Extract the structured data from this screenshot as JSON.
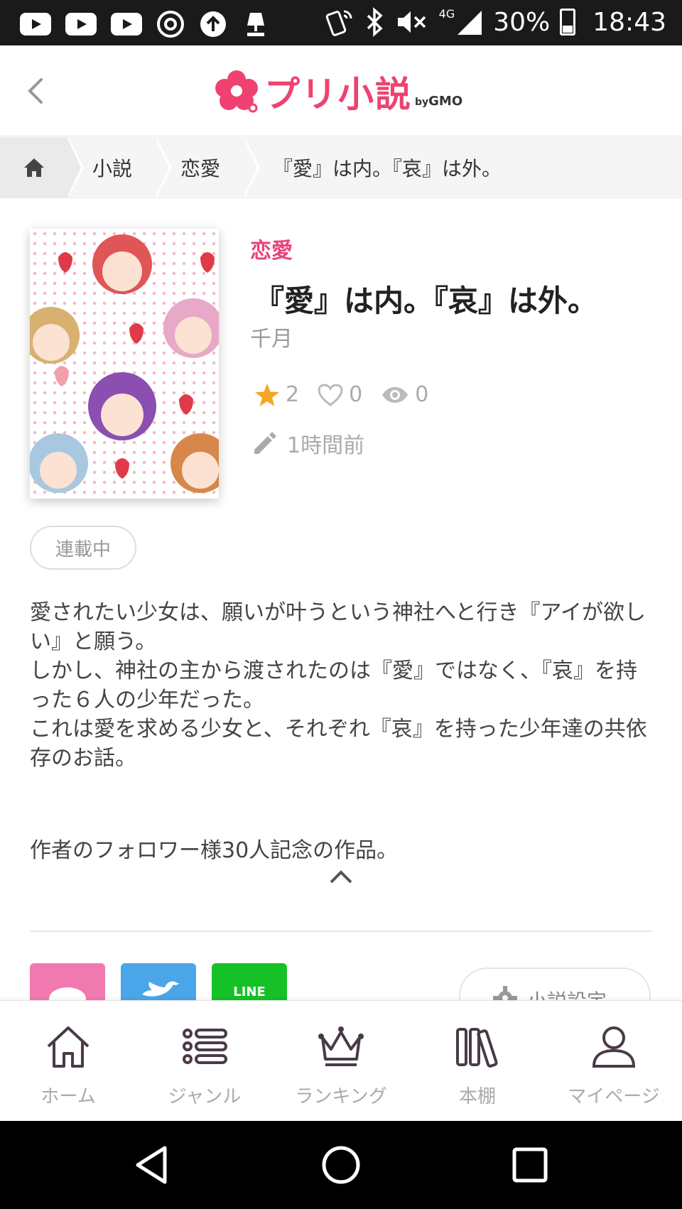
{
  "status_bar": {
    "battery": "30%",
    "time": "18:43",
    "network": "4G"
  },
  "header": {
    "logo_text": "プリ小説",
    "logo_by": "by",
    "logo_brand": "GMO"
  },
  "breadcrumb": {
    "items": [
      "小説",
      "恋愛",
      "『愛』は内。『哀』は外。"
    ]
  },
  "novel": {
    "genre": "恋愛",
    "title": "『愛』は内。『哀』は外。",
    "author": "千月",
    "stars": "2",
    "likes": "0",
    "views": "0",
    "updated": "1時間前",
    "status": "連載中",
    "synopsis": [
      "愛されたい少女は、願いが叶うという神社へと行き『アイが欲しい』と願う。",
      "しかし、神社の主から渡されたのは『愛』ではなく、『哀』を持った６人の少年だった。",
      "これは愛を求める少女と、それぞれ『哀』を持った少年達の共依存のお話。"
    ],
    "note": "作者のフォロワー様30人記念の作品。"
  },
  "actions": {
    "line_label": "LINE",
    "settings_label": "小説設定"
  },
  "bottom_nav": {
    "home": "ホーム",
    "genre": "ジャンル",
    "ranking": "ランキング",
    "bookshelf": "本棚",
    "mypage": "マイページ"
  },
  "colors": {
    "accent": "#e94378",
    "star": "#f5a623",
    "nav_icon": "#4a3a48"
  }
}
